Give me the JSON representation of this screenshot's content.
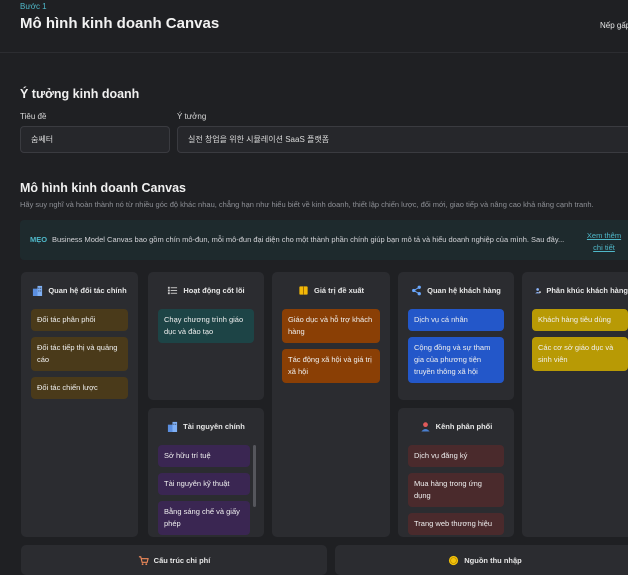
{
  "header": {
    "step": "Bước 1",
    "title": "Mô hình kinh doanh Canvas",
    "collapse_label": "Nếp gấp"
  },
  "idea": {
    "title": "Ý tưởng kinh doanh",
    "label_title": "Tiêu đề",
    "label_idea": "Ý tưởng",
    "value_title": "숨쎄터",
    "value_idea": "실전 창업을 위한 시뮬레이션 SaaS 플랫폼"
  },
  "canvas": {
    "title": "Mô hình kinh doanh Canvas",
    "subtitle": "Hãy suy nghĩ và hoàn thành nó từ nhiều góc độ khác nhau, chẳng hạn như hiểu biết về kinh doanh, thiết lập chiến lược, đổi mới, giao tiếp và nâng cao khả năng cạnh tranh."
  },
  "tip": {
    "tag": "MẸO",
    "text": "Business Model Canvas bao gồm chín mô-đun, mỗi mô-đun đại diện cho một thành phần chính giúp bạn mô tả và hiểu doanh nghiệp của mình. Sau đây...",
    "link_line1": "Xem thêm",
    "link_line2": "chi tiết"
  },
  "blocks": {
    "partners": {
      "title": "Quan hệ đối tác chính",
      "icon": "building-icon",
      "items": [
        "Đối tác phân phối",
        "Đối tác tiếp thị và quảng cáo",
        "Đối tác chiến lược"
      ]
    },
    "activities": {
      "title": "Hoạt động cốt lõi",
      "icon": "checklist-icon",
      "items": [
        "Chạy chương trình giáo dục và đào tạo"
      ]
    },
    "resources": {
      "title": "Tài nguyên chính",
      "icon": "building-icon",
      "items": [
        "Sở hữu trí tuệ",
        "Tài nguyên kỹ thuật",
        "Bằng sáng chế và giấy phép"
      ]
    },
    "value": {
      "title": "Giá trị đề xuất",
      "icon": "gift-icon",
      "items": [
        "Giáo dục và hỗ trợ khách hàng",
        "Tác động xã hội và giá trị xã hội"
      ]
    },
    "relations": {
      "title": "Quan hệ khách hàng",
      "icon": "share-icon",
      "items": [
        "Dịch vụ cá nhân",
        "Cộng đồng và sự tham gia của phương tiện truyền thông xã hội"
      ]
    },
    "channels": {
      "title": "Kênh phân phối",
      "icon": "person-icon",
      "items": [
        "Dịch vụ đăng ký",
        "Mua hàng trong ứng dụng",
        "Trang web thương hiệu"
      ]
    },
    "segments": {
      "title": "Phân khúc khách hàng",
      "icon": "user-settings-icon",
      "items": [
        "Khách hàng tiêu dùng",
        "Các cơ sở giáo dục và sinh viên"
      ]
    },
    "costs": {
      "title": "Cấu trúc chi phí",
      "icon": "cart-icon"
    },
    "revenue": {
      "title": "Nguồn thu nhập",
      "icon": "coin-icon"
    }
  },
  "colors": {
    "background": "#1f2023",
    "panel": "#2b2c30",
    "accent": "#4fb8c9",
    "partners_card": "#4a3a1a",
    "activities_card": "#1d4446",
    "resources_card": "#3a2652",
    "value_card": "#8a3f05",
    "relations_card": "#2357c9",
    "channels_card": "#4a2a2c",
    "segments_card": "#b89a05"
  }
}
